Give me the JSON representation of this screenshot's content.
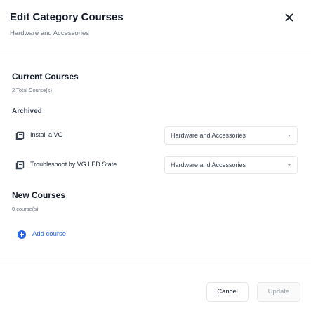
{
  "modal": {
    "title": "Edit Category Courses",
    "subtitle": "Hardware and Accessories",
    "close_icon": "close-icon"
  },
  "current_courses": {
    "title": "Current Courses",
    "count_label": "2 Total Course(s)",
    "groups": [
      {
        "label": "Archived",
        "courses": [
          {
            "icon": "course-icon",
            "name": "Install a VG",
            "category": "Hardware and Accessories"
          },
          {
            "icon": "course-icon",
            "name": "Troubleshoot by VG LED State",
            "category": "Hardware and Accessories"
          }
        ]
      }
    ]
  },
  "new_courses": {
    "title": "New Courses",
    "count_label": "0 course(s)",
    "add_label": "Add course",
    "add_icon": "plus-circle-icon"
  },
  "footer": {
    "cancel_label": "Cancel",
    "update_label": "Update"
  },
  "colors": {
    "accent": "#2563eb",
    "border": "#e5e7eb",
    "muted_text": "#6b7280"
  }
}
